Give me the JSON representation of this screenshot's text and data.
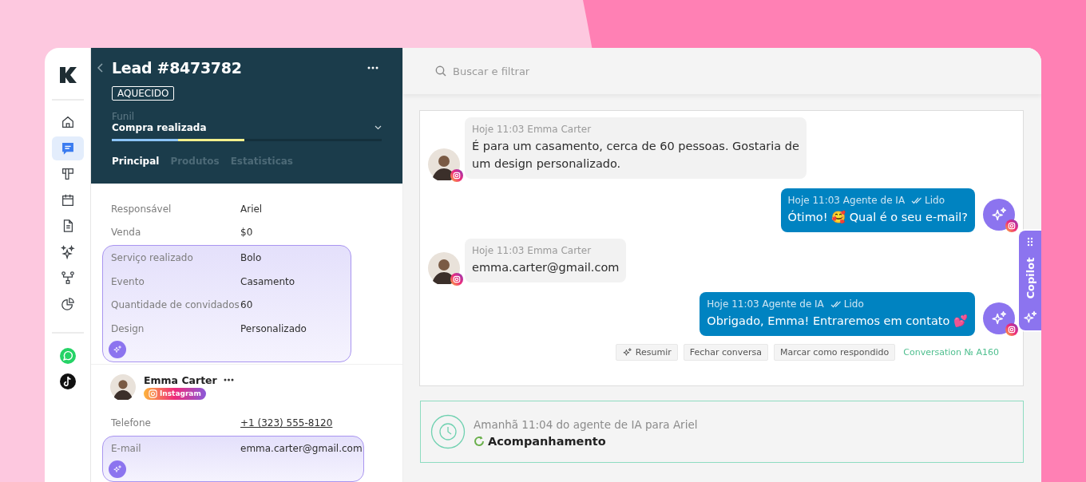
{
  "sidebar": {
    "nav_items": [
      {
        "selected": false
      },
      {
        "selected": true
      },
      {
        "selected": false
      },
      {
        "selected": false
      },
      {
        "selected": false
      },
      {
        "selected": false
      },
      {
        "selected": false
      },
      {
        "selected": false
      }
    ],
    "apps": [
      {
        "kind": "whatsapp"
      },
      {
        "kind": "tiktok"
      }
    ]
  },
  "lead": {
    "title": "Lead #8473782",
    "tag": "AQUECIDO",
    "funnel": {
      "label": "Funil",
      "value": "Compra realizada",
      "level": 0.49
    },
    "tabs": [
      {
        "label": "Principal",
        "selected": true
      },
      {
        "label": "Produtos",
        "selected": false
      },
      {
        "label": "Estatisticas",
        "selected": false
      }
    ],
    "field_groups": [
      {
        "ai_filled": false,
        "fields": [
          {
            "label": "Responsável",
            "value": "Ariel"
          },
          {
            "label": "Venda",
            "value": "$0"
          }
        ]
      },
      {
        "ai_filled": true,
        "fields": [
          {
            "label": "Serviço realizado",
            "value": "Bolo"
          },
          {
            "label": "Evento",
            "value": "Casamento"
          },
          {
            "label": "Quantidade de convidados",
            "value": "60"
          },
          {
            "label": "Design",
            "value": "Personalizado"
          }
        ]
      }
    ],
    "contact": {
      "name": "Emma Carter",
      "channel": "Instagram",
      "field_groups": [
        {
          "ai_filled": false,
          "fields": [
            {
              "label": "Telefone",
              "value": "+1 (323) 555-8120",
              "link": true
            }
          ]
        },
        {
          "ai_filled": true,
          "fields": [
            {
              "label": "E-mail",
              "value": "emma.carter@gmail.com",
              "link": false
            }
          ]
        }
      ]
    }
  },
  "search": {
    "placeholder": "Buscar e filtrar"
  },
  "messages": [
    {
      "kind": "in",
      "meta": "Hoje 11:03 Emma Carter",
      "text": "É para um casamento, cerca de 60 pessoas. Gostaria de um design personalizado."
    },
    {
      "kind": "out",
      "meta": "Hoje 11:03 Agente de IA",
      "status": "Lido",
      "text": "Ótimo! 🥰 Qual é o seu e-mail?"
    },
    {
      "kind": "in",
      "meta": "Hoje 11:03 Emma Carter",
      "text": "emma.carter@gmail.com"
    },
    {
      "kind": "out",
      "meta": "Hoje 11:03  Agente de IA",
      "status": "Lido",
      "text": "Obrigado, Emma! Entraremos em contato 💕"
    }
  ],
  "actions": [
    {
      "label": "Resumir",
      "kind": "ai"
    },
    {
      "label": "Fechar conversa",
      "kind": "plain"
    },
    {
      "label": "Marcar como respondido",
      "kind": "plain"
    }
  ],
  "conversation_id": "Conversation № A160",
  "followup": {
    "meta": "Amanhã 11:04 do agente de IA para Ariel",
    "title": "Acompanhamento"
  },
  "copilot": {
    "label": "Copilot"
  }
}
